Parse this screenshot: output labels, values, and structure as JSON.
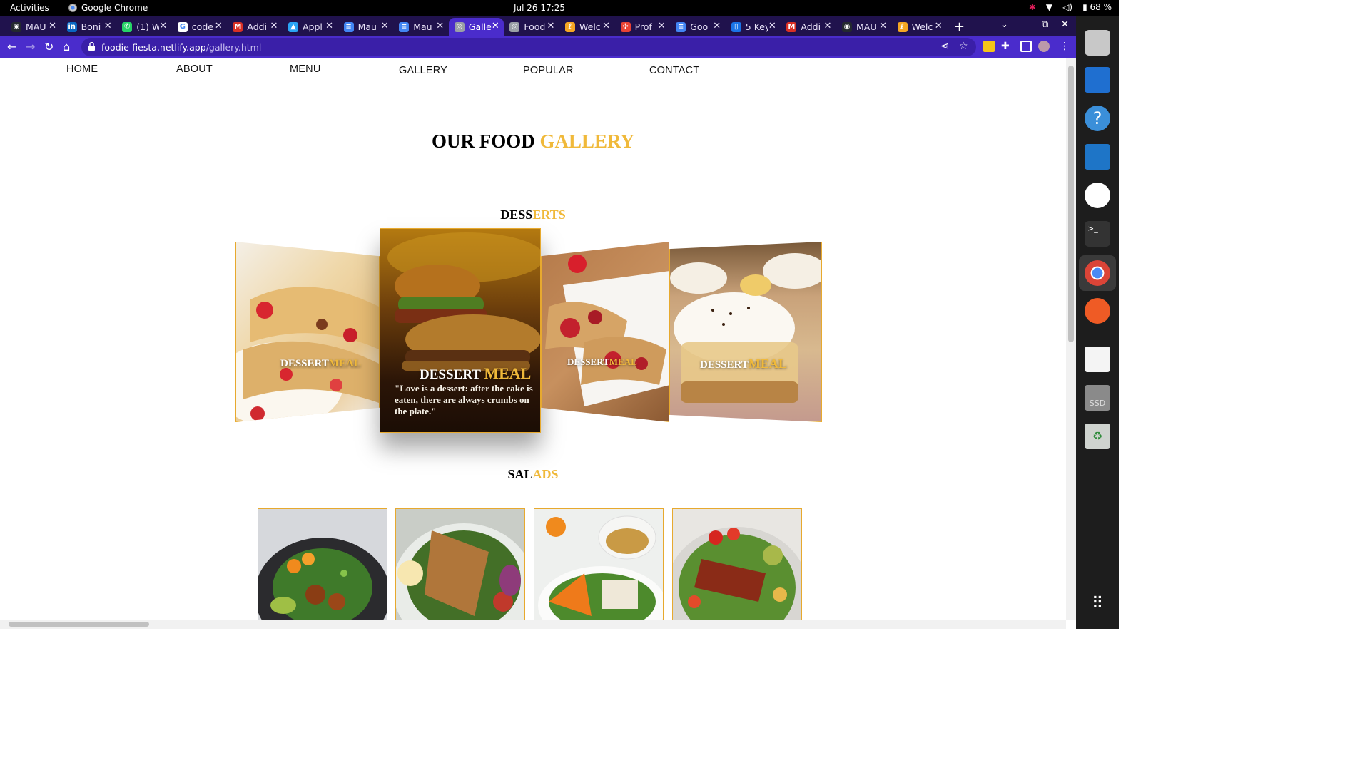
{
  "os": {
    "activities": "Activities",
    "app_name": "Google Chrome",
    "clock": "Jul 26  17:25",
    "battery": "68 %"
  },
  "tabs": [
    {
      "label": "MAU",
      "color": "#24292f",
      "glyph": "◉"
    },
    {
      "label": "Boni",
      "color": "#0a66c2",
      "glyph": "in"
    },
    {
      "label": "(1) W",
      "color": "#25d366",
      "glyph": "✆"
    },
    {
      "label": "code",
      "color": "#ffffff",
      "glyph": "G"
    },
    {
      "label": "Addi",
      "color": "#d93025",
      "glyph": "M"
    },
    {
      "label": "Appl",
      "color": "#2aa4f4",
      "glyph": "▲"
    },
    {
      "label": "Mau",
      "color": "#4285f4",
      "glyph": "≡"
    },
    {
      "label": "Mau",
      "color": "#4285f4",
      "glyph": "≡"
    },
    {
      "label": "Galle",
      "color": "#9aa0a6",
      "glyph": "◎",
      "active": true
    },
    {
      "label": "Food",
      "color": "#9aa0a6",
      "glyph": "◎"
    },
    {
      "label": "Welc",
      "color": "#f5a623",
      "glyph": "ℓ"
    },
    {
      "label": "Prof",
      "color": "#ea4335",
      "glyph": "✣"
    },
    {
      "label": "Goo",
      "color": "#4285f4",
      "glyph": "≡"
    },
    {
      "label": "5 Key",
      "color": "#1a73e8",
      "glyph": "▯"
    },
    {
      "label": "Addi",
      "color": "#d93025",
      "glyph": "M"
    },
    {
      "label": "MAU",
      "color": "#24292f",
      "glyph": "◉"
    },
    {
      "label": "Welc",
      "color": "#f5a623",
      "glyph": "ℓ"
    }
  ],
  "address": {
    "host": "foodie-fiesta.netlify.app",
    "path": "/gallery.html"
  },
  "nav": {
    "home": "HOME",
    "about": "ABOUT",
    "menu": "MENU",
    "gallery": "GALLERY",
    "popular": "POPULAR",
    "contact": "CONTACT"
  },
  "title": {
    "part1": "OUR FOOD",
    "part2": "GALLERY"
  },
  "desserts": {
    "heading_a": "DESS",
    "heading_b": "ERTS",
    "cards": [
      {
        "cap_a": "DESSERT",
        "cap_b": "MEAL"
      },
      {
        "cap_a": "DESSERT",
        "cap_b": "MEAL",
        "quote": "\"Love is a dessert: after the cake is eaten, there are always crumbs on the plate.\""
      },
      {
        "cap_a": "DESSERT",
        "cap_b": "MEAL"
      },
      {
        "cap_a": "DESSERT",
        "cap_b": "MEAL"
      }
    ]
  },
  "salads": {
    "heading_a": "SAL",
    "heading_b": "ADS"
  },
  "colors": {
    "accent": "#f0b93a",
    "chrome_purple": "#4a2ccc",
    "border_gold": "#e7a92e"
  },
  "dock_apps": [
    "files-icon",
    "writer-icon",
    "help-icon",
    "vscode-icon",
    "slack-icon",
    "terminal-icon",
    "chrome-icon",
    "postman-icon",
    "text-editor-icon",
    "ssd-icon",
    "trash-icon",
    "app-grid-icon"
  ]
}
